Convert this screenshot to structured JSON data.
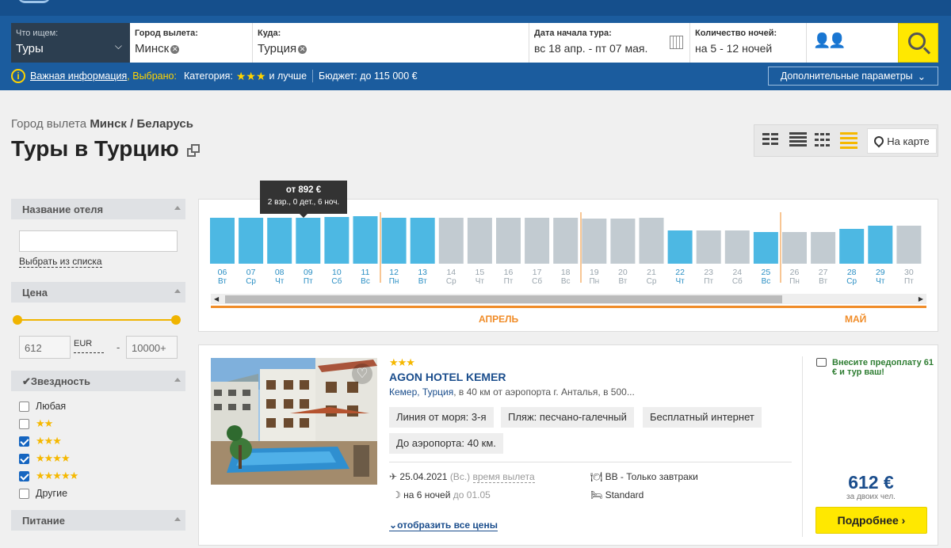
{
  "colors": {
    "header": "#1b5c9e",
    "accent_yellow": "#ffe800",
    "bar_blue": "#4db8e3",
    "bar_grey": "#c2cbd1",
    "month_orange": "#f08c28",
    "link_blue": "#1a4d8c"
  },
  "search": {
    "what": {
      "label": "Что ищем:",
      "value": "Туры"
    },
    "from": {
      "label": "Город вылета:",
      "value": "Минск"
    },
    "to": {
      "label": "Куда:",
      "value": "Турция"
    },
    "date": {
      "label": "Дата начала тура:",
      "value": "вс 18 апр. - пт 07 мая."
    },
    "nights": {
      "label": "Количество ночей:",
      "value": "на 5 - 12 ночей"
    },
    "icons": {
      "search": "search-icon",
      "calendar": "calendar-icon",
      "people": "people-icon",
      "clear": "clear-icon"
    }
  },
  "info": {
    "important": "Важная информация",
    "selected": ", Выбрано:",
    "category_label": "Категория:",
    "category_stars": "★★★",
    "category_suffix": "и лучше",
    "budget": "Бюджет: до 115 000 €",
    "more_params": "Дополнительные параметры"
  },
  "page": {
    "crumb_prefix": "Город вылета",
    "crumb_city": "Минск / Беларусь",
    "title": "Туры в Турцию",
    "map_label": "На карте"
  },
  "sidebar": {
    "hotel_name": {
      "title": "Название отеля",
      "value": "",
      "link": "Выбрать из списка"
    },
    "price": {
      "title": "Цена",
      "min": "612",
      "currency": "EUR",
      "max": "10000+"
    },
    "stars": {
      "title": "Звездность",
      "items": [
        {
          "label": "Любая",
          "stars": "",
          "checked": false
        },
        {
          "label": "",
          "stars": "★★",
          "checked": false
        },
        {
          "label": "",
          "stars": "★★★",
          "checked": true
        },
        {
          "label": "",
          "stars": "★★★★",
          "checked": true
        },
        {
          "label": "",
          "stars": "★★★★★",
          "checked": true
        },
        {
          "label": "Другие",
          "stars": "",
          "checked": false
        }
      ]
    },
    "food": {
      "title": "Питание"
    }
  },
  "chart_data": {
    "type": "bar",
    "categories": [
      "06",
      "07",
      "08",
      "09",
      "10",
      "11",
      "12",
      "13",
      "14",
      "15",
      "16",
      "17",
      "18",
      "19",
      "20",
      "21",
      "22",
      "23",
      "24",
      "25",
      "26",
      "27",
      "28",
      "29",
      "30"
    ],
    "weekdays": [
      "Вт",
      "Ср",
      "Чт",
      "Пт",
      "Сб",
      "Вс",
      "Пн",
      "Вт",
      "Ср",
      "Чт",
      "Пт",
      "Сб",
      "Вс",
      "Пн",
      "Вт",
      "Ср",
      "Чт",
      "Пт",
      "Сб",
      "Вс",
      "Пн",
      "Вт",
      "Ср",
      "Чт",
      "Пт"
    ],
    "values": [
      58,
      58,
      58,
      58,
      59,
      60,
      58,
      58,
      58,
      58,
      58,
      58,
      58,
      57,
      57,
      58,
      42,
      42,
      42,
      40,
      40,
      40,
      44,
      48,
      48
    ],
    "selected": [
      true,
      true,
      true,
      true,
      true,
      true,
      true,
      true,
      false,
      false,
      false,
      false,
      false,
      false,
      false,
      false,
      true,
      false,
      false,
      true,
      false,
      false,
      true,
      true,
      false
    ],
    "months": [
      "АПРЕЛЬ",
      "МАЙ"
    ],
    "ylim": [
      0,
      60
    ],
    "tooltip": {
      "price": "от 892 €",
      "details": "2 взр., 0 дет., 6 ноч."
    }
  },
  "hotel": {
    "stars": "★★★",
    "name": "AGON HOTEL KEMER",
    "location": "Кемер, Турция",
    "distance": ", в 40 км от аэропорта г. Анталья, в 500...",
    "tags": [
      "Линия от моря: 3-я",
      "Пляж: песчано-галечный",
      "Бесплатный интернет",
      "До аэропорта: 40 км."
    ],
    "date": "25.04.2021",
    "weekday": "(Вс.)",
    "flight_time": "время вылета",
    "nights": "на 6 ночей",
    "until": "до 01.05",
    "meal": "BB - Только завтраки",
    "room": "Standard",
    "all_prices": "отобразить все цены",
    "prepay": "Внесите предоплату 61 € и тур ваш!",
    "price": "612 €",
    "price_note": "за двоих чел.",
    "more": "Подробнее ›"
  }
}
